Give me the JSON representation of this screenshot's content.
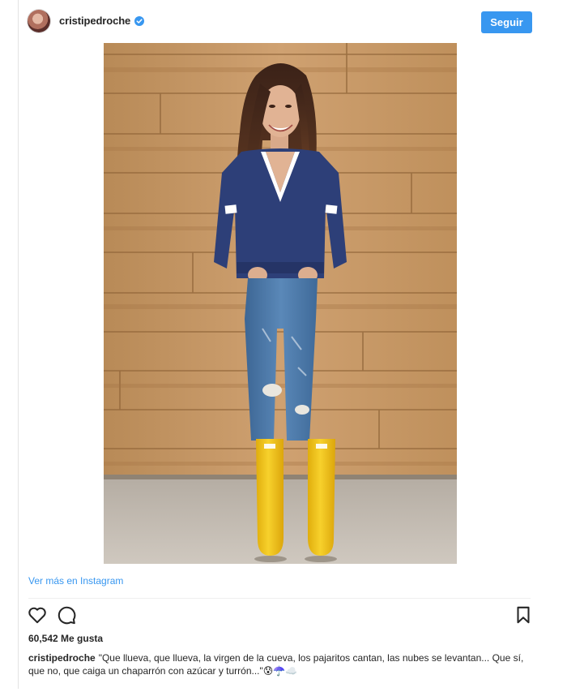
{
  "post": {
    "username": "cristipedroche",
    "follow_label": "Seguir",
    "view_more_label": "Ver más en Instagram",
    "likes_text": "60,542 Me gusta",
    "caption_text": "\"Que llueva, que llueva, la virgen de la cueva, los pajaritos cantan, las nubes se levantan... Que sí, que no, que caiga un chaparrón con azúcar y turrón...\"",
    "caption_emojis": "😰☂️☁️"
  },
  "icons": {
    "verified": "verified-badge-icon",
    "like": "heart-icon",
    "comment": "comment-bubble-icon",
    "save": "bookmark-icon"
  },
  "colors": {
    "accent": "#3897f0",
    "text": "#262626",
    "divider": "#efefef",
    "boots": "#f2c318",
    "sweater": "#2d3f78",
    "jeans": "#4a78a8"
  }
}
